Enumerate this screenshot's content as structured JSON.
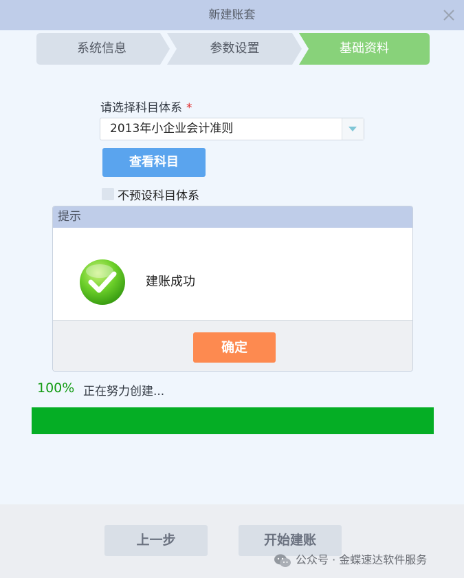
{
  "window": {
    "title": "新建账套"
  },
  "steps": [
    {
      "label": "系统信息",
      "active": false
    },
    {
      "label": "参数设置",
      "active": false
    },
    {
      "label": "基础资料",
      "active": true
    }
  ],
  "form": {
    "account_system_label": "请选择科目体系",
    "required_mark": "*",
    "account_system_value": "2013年小企业会计准则",
    "view_button_label": "查看科目",
    "no_preset_label": "不预设科目体系",
    "no_preset_checked": false
  },
  "modal": {
    "title": "提示",
    "message": "建账成功",
    "confirm_label": "确定",
    "icon": "check-circle-icon"
  },
  "progress": {
    "percent_label": "100%",
    "percent_value": 100,
    "status_text": "正在努力创建..."
  },
  "footer": {
    "prev_label": "上一步",
    "start_label": "开始建账"
  },
  "watermark": {
    "text": "公众号 · 金蝶速达软件服务"
  },
  "colors": {
    "titlebar": "#bfcde9",
    "step_inactive": "#d8e0ea",
    "step_active": "#88d27a",
    "primary_button": "#5aa4ee",
    "confirm_button": "#fd8a50",
    "progress_fill": "#05ae25",
    "progress_text": "#129b12",
    "required": "#e02b2b"
  }
}
